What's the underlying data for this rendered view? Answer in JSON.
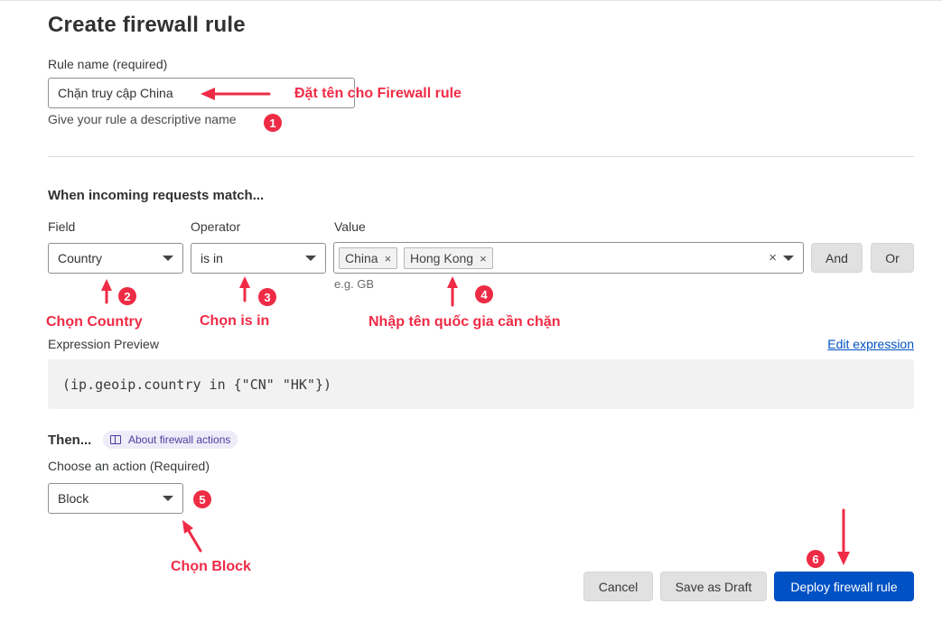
{
  "page": {
    "title": "Create firewall rule"
  },
  "rule_name": {
    "label": "Rule name (required)",
    "value": "Chặn truy cập China",
    "help": "Give your rule a descriptive name"
  },
  "match": {
    "heading": "When incoming requests match...",
    "field": {
      "label": "Field",
      "value": "Country"
    },
    "operator": {
      "label": "Operator",
      "value": "is in"
    },
    "value": {
      "label": "Value",
      "chips": [
        "China",
        "Hong Kong"
      ],
      "chip_remove": "×",
      "clear": "×",
      "hint": "e.g. GB"
    },
    "and_label": "And",
    "or_label": "Or"
  },
  "expression": {
    "label": "Expression Preview",
    "edit_link": "Edit expression",
    "code": "(ip.geoip.country in {\"CN\" \"HK\"})"
  },
  "then": {
    "heading": "Then...",
    "about_link": "About firewall actions",
    "action_label": "Choose an action (Required)",
    "action_value": "Block"
  },
  "footer": {
    "cancel": "Cancel",
    "save_draft": "Save as Draft",
    "deploy": "Deploy firewall rule"
  },
  "annotations": {
    "note_name": "Đặt tên cho Firewall rule",
    "note_country": "Chọn Country",
    "note_operator": "Chọn is in",
    "note_value": "Nhập tên quốc gia cần chặn",
    "note_block": "Chọn Block",
    "badges": [
      "1",
      "2",
      "3",
      "4",
      "5",
      "6"
    ],
    "color": "#ef2b46"
  },
  "colors": {
    "primary": "#0051c3",
    "annotation": "#ef2b46"
  },
  "icons": {
    "select_caret": "caret-down-icon",
    "about": "book-icon",
    "arrow": "arrow-icon"
  }
}
